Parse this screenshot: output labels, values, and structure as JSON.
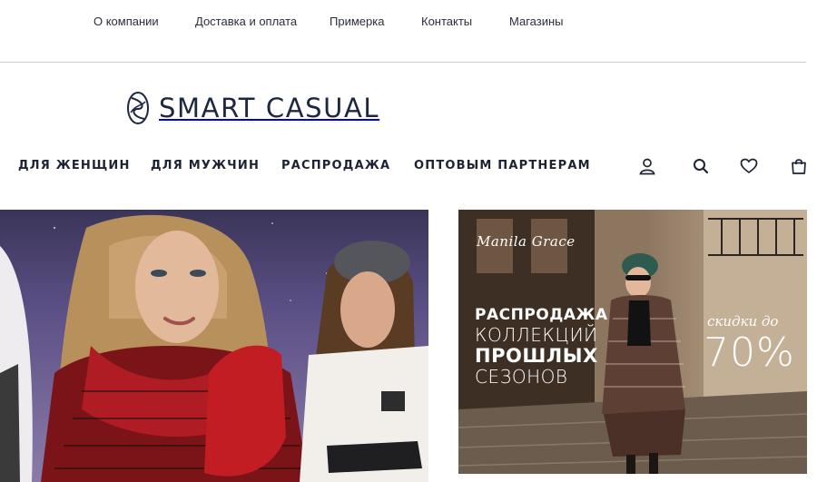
{
  "top_nav": {
    "items": [
      "О компании",
      "Доставка и оплата",
      "Примерка",
      "Контакты",
      "Магазины"
    ]
  },
  "logo": {
    "text": "SMART CASUAL",
    "icon": "knot-logo-icon"
  },
  "main_nav": {
    "items": [
      "ДЛЯ ЖЕНЩИН",
      "ДЛЯ МУЖЧИН",
      "РАСПРОДАЖА",
      "ОПТОВЫМ ПАРТНЕРАМ"
    ]
  },
  "header_icons": [
    "user-icon",
    "search-icon",
    "heart-icon",
    "bag-icon"
  ],
  "banner_right": {
    "brand": "Manila Grace",
    "sale_lines": [
      "РАСПРОДАЖА",
      "КОЛЛЕКЦИЙ",
      "ПРОШЛЫХ",
      "СЕЗОНОВ"
    ],
    "discount_label": "скидки до",
    "discount_value": "70%"
  },
  "colors": {
    "text": "#1c2333",
    "logo": "#1c2740",
    "divider": "#c9cbd0",
    "accent_red": "#c21d23"
  }
}
